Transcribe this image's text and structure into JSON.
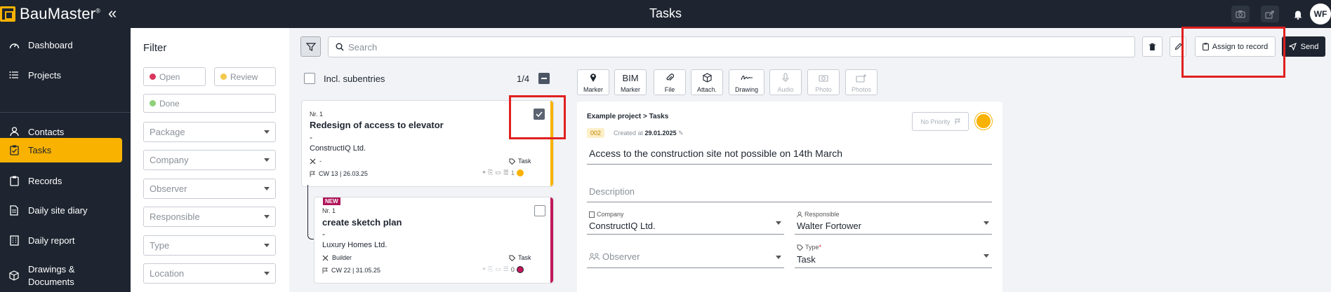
{
  "app": {
    "name": "BauMaster",
    "trademark": "®",
    "page_title": "Tasks",
    "user_initials": "WF"
  },
  "header_icons": [
    "camera-icon",
    "share-icon",
    "bell-icon"
  ],
  "sidebar": {
    "items": [
      {
        "label": "Dashboard",
        "icon": "dashboard-icon"
      },
      {
        "label": "Projects",
        "icon": "list-icon"
      },
      {
        "label": "Contacts",
        "icon": "person-icon"
      },
      {
        "label": "Tasks",
        "icon": "clipboard-check-icon",
        "active": true
      },
      {
        "label": "Records",
        "icon": "clipboard-icon"
      },
      {
        "label": "Daily site diary",
        "icon": "document-icon"
      },
      {
        "label": "Daily report",
        "icon": "building-icon"
      },
      {
        "label": "Drawings &",
        "label2": "Documents",
        "icon": "cube-icon"
      }
    ]
  },
  "filter": {
    "title": "Filter",
    "status_chips": [
      {
        "label": "Open",
        "color": "#d9365e"
      },
      {
        "label": "Review",
        "color": "#f2c94c"
      },
      {
        "label": "Done",
        "color": "#8fd17a"
      }
    ],
    "selects": [
      "Package",
      "Company",
      "Observer",
      "Responsible",
      "Type",
      "Location"
    ]
  },
  "toolbar": {
    "search_placeholder": "Search",
    "assign_label": "Assign to record",
    "send_label": "Send"
  },
  "list": {
    "incl_subentries": "Incl. subentries",
    "count": "1/4",
    "tasks": [
      {
        "nr": "Nr. 1",
        "title": "Redesign of access to elevator",
        "dash": "-",
        "company": "ConstructIQ Ltd.",
        "subtitle": "-",
        "tag": "Task",
        "date": "CW 13 | 26.03.25",
        "comments": "1",
        "checked": true,
        "stripe_color": "#f9b200",
        "status_color": "#f9b200"
      },
      {
        "badge": "NEW",
        "nr": "Nr. 1",
        "title": "create sketch plan",
        "dash": "-",
        "company": "Luxury Homes Ltd.",
        "subtitle": "Builder",
        "tag": "Task",
        "date": "CW 22 | 31.05.25",
        "comments": "0",
        "checked": false,
        "stripe_color": "#c2185b",
        "status_color": "#c2185b"
      }
    ]
  },
  "detail_tabs": [
    {
      "line1": "",
      "line2": "Marker",
      "icon": "pin-icon",
      "disabled": false
    },
    {
      "line1": "BIM",
      "line2": "Marker",
      "icon": "",
      "disabled": false
    },
    {
      "line1": "",
      "line2": "File",
      "icon": "paperclip-icon",
      "disabled": false
    },
    {
      "line1": "",
      "line2": "Attach.",
      "icon": "cube-icon",
      "disabled": false
    },
    {
      "line1": "",
      "line2": "Drawing",
      "icon": "signature-icon",
      "disabled": false
    },
    {
      "line1": "",
      "line2": "Audio",
      "icon": "microphone-icon",
      "disabled": true
    },
    {
      "line1": "",
      "line2": "Photo",
      "icon": "camera-icon",
      "disabled": true
    },
    {
      "line1": "",
      "line2": "Photos",
      "icon": "add-photos-icon",
      "disabled": true
    }
  ],
  "detail": {
    "breadcrumb": "Example project > Tasks",
    "id": "002",
    "created_prefix": "Created at ",
    "created_date": "29.01.2025",
    "priority": "No Priority",
    "title": "Access to the construction site not possible on 14th March",
    "description_placeholder": "Description",
    "company_label": "Company",
    "company_value": "ConstructIQ Ltd.",
    "responsible_label": "Responsible",
    "responsible_value": "Walter Fortower",
    "observer_label": "Observer",
    "type_label": "Type",
    "type_required": "*",
    "type_value": "Task"
  },
  "colors": {
    "dark": "#1e2530",
    "accent": "#f9b200",
    "highlight": "#e02020"
  }
}
